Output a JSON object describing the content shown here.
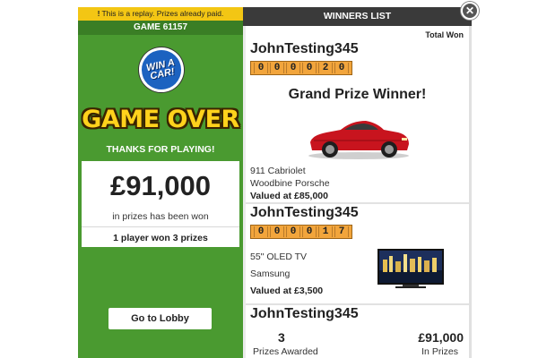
{
  "left": {
    "replay_icon": "warning-icon",
    "replay_notice": "This is a replay. Prizes already paid.",
    "game_number": "GAME 61157",
    "logo_text_line1": "WIN A",
    "logo_text_line2": "CAR!",
    "game_over": "GAME OVER",
    "thanks": "THANKS FOR PLAYING!",
    "prize_amount": "£91,000",
    "prize_sub": "in prizes has been won",
    "winners_summary": "1 player won 3 prizes",
    "lobby_button": "Go to Lobby"
  },
  "right": {
    "header": "WINNERS LIST",
    "total_won_label": "Total Won",
    "winners": [
      {
        "username": "JohnTesting345",
        "ticket": [
          "0",
          "0",
          "0",
          "0",
          "2",
          "0"
        ],
        "title": "Grand Prize Winner!",
        "item_name": "911 Cabriolet",
        "item_brand": "Woodbine Porsche",
        "item_value": "Valued at £85,000",
        "image": "red-car-image"
      },
      {
        "username": "JohnTesting345",
        "ticket": [
          "0",
          "0",
          "0",
          "0",
          "1",
          "7"
        ],
        "item_name": "55\" OLED TV",
        "item_brand": "Samsung",
        "item_value": "Valued at £3,500",
        "image": "tv-image"
      },
      {
        "username": "JohnTesting345"
      }
    ],
    "stats": {
      "prizes_count": "3",
      "prizes_label": "Prizes Awarded",
      "total_amount": "£91,000",
      "total_label": "In Prizes"
    }
  },
  "close_icon": "close-icon",
  "colors": {
    "panel_green": "#4a9a30",
    "banner_yellow": "#f3c614",
    "header_dark": "#3a3a3a",
    "ticket_orange": "#f2a53c",
    "game_over_yellow": "#ffd21c"
  }
}
